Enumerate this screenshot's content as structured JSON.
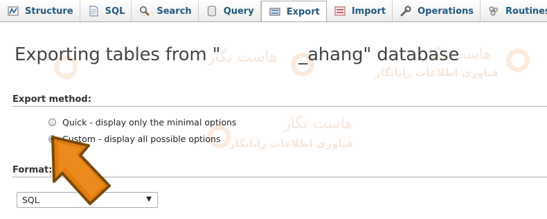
{
  "tabs": [
    {
      "label": "Structure",
      "icon": "structure-icon",
      "active": false
    },
    {
      "label": "SQL",
      "icon": "sql-icon",
      "active": false
    },
    {
      "label": "Search",
      "icon": "search-icon",
      "active": false
    },
    {
      "label": "Query",
      "icon": "query-icon",
      "active": false
    },
    {
      "label": "Export",
      "icon": "export-icon",
      "active": true
    },
    {
      "label": "Import",
      "icon": "import-icon",
      "active": false
    },
    {
      "label": "Operations",
      "icon": "wrench-icon",
      "active": false
    },
    {
      "label": "Routines",
      "icon": "routines-icon",
      "active": false
    },
    {
      "label": "",
      "icon": "events-clock-icon",
      "active": false
    }
  ],
  "page": {
    "title": "Exporting tables from \"              _ahang\" database"
  },
  "export_method": {
    "heading": "Export method:",
    "options": [
      {
        "label": "Quick - display only the minimal options",
        "checked": false
      },
      {
        "label": "Custom - display all possible options",
        "checked": true
      }
    ]
  },
  "format": {
    "heading": "Format:",
    "selected": "SQL"
  },
  "watermark": {
    "line1": "هاست نگار",
    "line2": "فناوری اطلاعات رایانگار"
  },
  "colors": {
    "tab_text": "#235a81",
    "arrow_fill": "#e07c10",
    "arrow_stroke": "#7a4a08",
    "watermark": "#c25400"
  }
}
